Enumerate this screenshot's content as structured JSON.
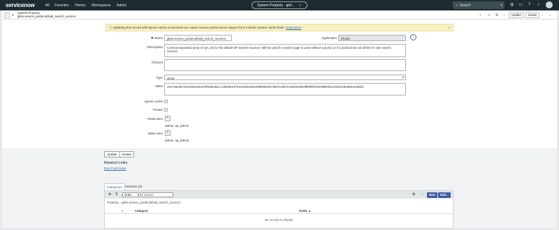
{
  "topbar": {
    "logo": "servicenow",
    "nav": [
      "All",
      "Favorites",
      "History",
      "Workspaces",
      "Admin"
    ],
    "center_title": "System Property - glid...",
    "center_star": "☆",
    "search_placeholder": "Search"
  },
  "header": {
    "type": "System Property",
    "name": "glide.service_portal.default_search_sources",
    "update": "Update",
    "delete": "Delete"
  },
  "alert": {
    "text": "Updating this record with ignore cache unchecked can cause serious performance impact from a whole system cache flush.",
    "link": "Read More",
    "close": "×"
  },
  "form": {
    "name_label": "Name",
    "name_value": "glide.service_portal.default_search_sources",
    "application_label": "Application",
    "application_value": "Global",
    "description_label": "Description",
    "description_value": "Comma-separated array of sys_ids for the default SP Search Sources. Will be used if a search page is used without a portal, or if a portal does not define it's own search sources.",
    "choices_label": "Choices",
    "type_label": "Type",
    "type_value": "string",
    "value_label": "Value",
    "value_value": "c6170aed6721220023c82e08f1b5e9a1c,435a0610761220023c82e08f585ef3cc9befc1687212200230e08f0bf9fc93c0f960f1e1d101119ea89c1ed0b4",
    "ignore_label": "Ignore cache",
    "private_label": "Private",
    "read_label": "Read roles",
    "read_value": "admin, sp_admin",
    "write_label": "Write roles",
    "write_value": "admin, sp_admin"
  },
  "bottom": {
    "update": "Update",
    "delete": "Delete",
    "related_links": "Related Links",
    "run_point_scan": "Run Point Scan",
    "tabs": [
      "Categories",
      "Versions (4)"
    ],
    "list": {
      "order_select": "Order",
      "search_placeholder": "Search",
      "new": "New",
      "edit": "Edit...",
      "crumb": "Property = glide.service_portal.default_search_sources",
      "col_category": "Category",
      "col_order": "Order ▲",
      "empty": "No records to display"
    }
  }
}
